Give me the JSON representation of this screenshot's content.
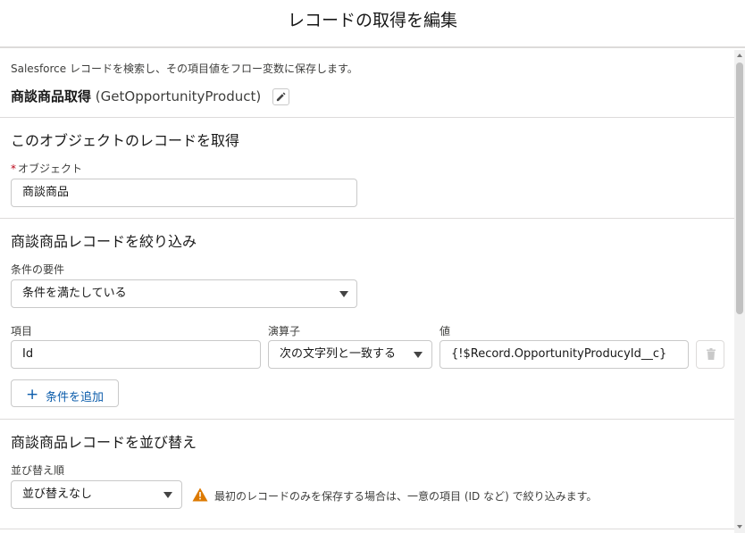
{
  "modal": {
    "title": "レコードの取得を編集"
  },
  "element": {
    "description": "Salesforce レコードを検索し、その項目値をフロー変数に保存します。",
    "label": "商談商品取得",
    "api_name": "(GetOpportunityProduct)"
  },
  "object_section": {
    "title": "このオブジェクトのレコードを取得",
    "object_label": "オブジェクト",
    "required_mark": "*",
    "object_value": "商談商品"
  },
  "filter_section": {
    "title": "商談商品レコードを絞り込み",
    "requirement_label": "条件の要件",
    "requirement_value": "条件を満たしている",
    "columns": {
      "field": "項目",
      "operator": "演算子",
      "value": "値"
    },
    "conditions": [
      {
        "field": "Id",
        "operator": "次の文字列と一致する",
        "value": "{!$Record.OpportunityProducyId__c}"
      }
    ],
    "add_condition_label": "条件を追加"
  },
  "sort_section": {
    "title": "商談商品レコードを並び替え",
    "order_label": "並び替え順",
    "order_value": "並び替えなし",
    "warning": "最初のレコードのみを保存する場合は、一意の項目 (ID など) で絞り込みます。"
  },
  "colors": {
    "accent": "#0b5cab",
    "warning": "#dd7a01",
    "border": "#c9c9c9",
    "divider": "#dddbda"
  },
  "icons": [
    "pencil-icon",
    "caret-down-icon",
    "trash-icon",
    "plus-icon",
    "warning-icon"
  ]
}
